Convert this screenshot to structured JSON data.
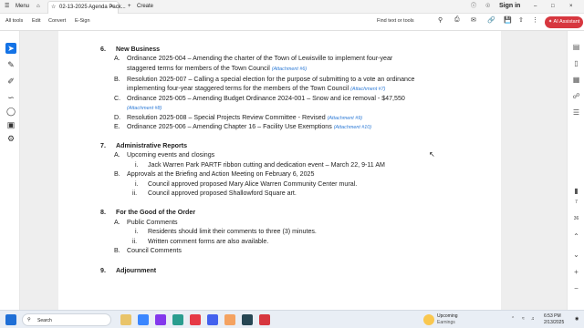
{
  "titlebar": {
    "menu_label": "Menu",
    "tab_title": "02-13-2025 Agenda Pack...",
    "create_label": "Create",
    "signin_label": "Sign in"
  },
  "toolbar": {
    "menu_items": [
      "All tools",
      "Edit",
      "Convert",
      "E-Sign"
    ],
    "find_label": "Find text or tools",
    "ai_assistant_label": "AI Assistant",
    "accent_color": "#d7373f"
  },
  "document": {
    "sections": [
      {
        "number": "6.",
        "title": "New Business",
        "items": [
          {
            "letter": "A.",
            "text": "Ordinance 2025-004 – Amending the charter of the Town of Lewisville to implement four-year",
            "cont": "staggered terms for members of the Town Council",
            "attachment": "(Attachment #6)"
          },
          {
            "letter": "B.",
            "text": "Resolution 2025-007 – Calling a special election for the purpose of submitting to a vote an ordinance",
            "cont": "implementing four-year staggered terms for the members of the Town Council",
            "attachment": "(Attachment #7)"
          },
          {
            "letter": "C.",
            "text": "Ordinance 2025-005 – Amending Budget Ordinance 2024-001 – Snow and ice removal - $47,550",
            "attachment": "(Attachment #8)"
          },
          {
            "letter": "D.",
            "text": "Resolution 2025-008 – Special Projects Review Committee - Revised",
            "attachment": "(Attachment #9)"
          },
          {
            "letter": "E.",
            "text": "Ordinance 2025-006 – Amending Chapter 16 – Facility Use Exemptions",
            "attachment": "(Attachment #10)"
          }
        ]
      },
      {
        "number": "7.",
        "title": "Administrative Reports",
        "items": [
          {
            "letter": "A.",
            "text": "Upcoming events and closings"
          },
          {
            "letter": "i.",
            "text": "Jack Warren Park PARTF ribbon cutting and dedication event – March 22, 9-11 AM"
          },
          {
            "letter": "B.",
            "text": "Approvals at the Briefing and Action Meeting on February 6, 2025"
          },
          {
            "letter": "i.",
            "text": "Council approved proposed Mary Alice Warren Community Center mural."
          },
          {
            "letter": "ii.",
            "text": "Council approved proposed Shallowford Square art."
          }
        ]
      },
      {
        "number": "8.",
        "title": "For the Good of the Order",
        "items": [
          {
            "letter": "A.",
            "text": "Public Comments"
          },
          {
            "letter": "i.",
            "text": "Residents should limit their comments to three (3) minutes."
          },
          {
            "letter": "ii.",
            "text": "Written comment forms are also available."
          },
          {
            "letter": "B.",
            "text": "Council Comments"
          }
        ]
      },
      {
        "number": "9.",
        "title": "Adjournment"
      }
    ]
  },
  "right_rail": {
    "page_current": "7",
    "page_total": "36"
  },
  "taskbar": {
    "search_placeholder": "Search",
    "weather_label": "Upcoming",
    "weather_sub": "Earnings",
    "time": "6:53 PM",
    "date": "2/13/2025"
  }
}
